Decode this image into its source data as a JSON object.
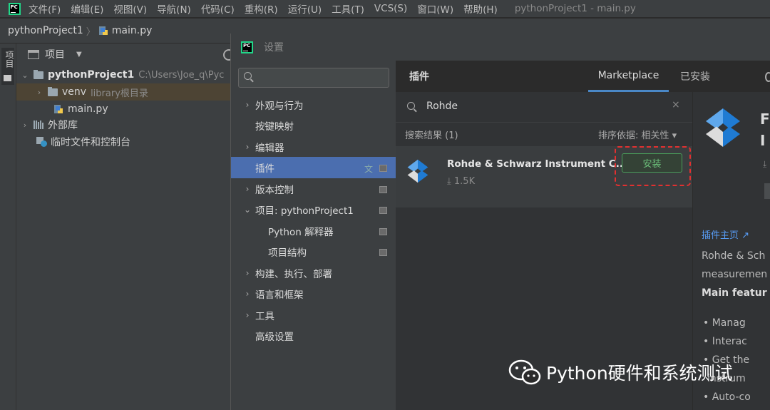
{
  "menubar": {
    "logo_text": "PC",
    "items": [
      "文件(F)",
      "编辑(E)",
      "视图(V)",
      "导航(N)",
      "代码(C)",
      "重构(R)",
      "运行(U)",
      "工具(T)",
      "VCS(S)",
      "窗口(W)",
      "帮助(H)"
    ],
    "window_title": "pythonProject1 - main.py"
  },
  "navbar": {
    "project": "pythonProject1",
    "separator": "〉",
    "file": "main.py"
  },
  "stripe": {
    "tab_label": "项目"
  },
  "project_panel": {
    "header": "项目",
    "root_name": "pythonProject1",
    "root_path": "C:\\Users\\Joe_q\\Pyc",
    "venv": "venv",
    "venv_hint": "library根目录",
    "main_file": "main.py",
    "external_libs": "外部库",
    "scratches": "临时文件和控制台"
  },
  "dialog": {
    "title": "设置",
    "nav": [
      {
        "label": "外观与行为",
        "arrow": "›"
      },
      {
        "label": "按键映射",
        "arrow": ""
      },
      {
        "label": "编辑器",
        "arrow": "›"
      },
      {
        "label": "插件",
        "arrow": "",
        "selected": true
      },
      {
        "label": "版本控制",
        "arrow": "›"
      },
      {
        "label": "项目: pythonProject1",
        "arrow": "⌄"
      },
      {
        "label": "Python 解释器",
        "arrow": ""
      },
      {
        "label": "项目结构",
        "arrow": ""
      },
      {
        "label": "构建、执行、部署",
        "arrow": "›"
      },
      {
        "label": "语言和框架",
        "arrow": "›"
      },
      {
        "label": "工具",
        "arrow": "›"
      },
      {
        "label": "高级设置",
        "arrow": ""
      }
    ],
    "plugins_header": "插件",
    "tab_marketplace": "Marketplace",
    "tab_installed": "已安装",
    "search_value": "Rohde",
    "results_label": "搜索结果 (1)",
    "sort_label": "排序依据: 相关性",
    "plugin_name": "Rohde & Schwarz Instrument C...",
    "plugin_downloads": "1.5K",
    "install_button": "安装",
    "detail": {
      "title_fragment_1": "F",
      "title_fragment_2": "I",
      "homepage": "插件主页",
      "desc_line1": "Rohde & Sch",
      "desc_line2": "measuremen",
      "features_heading": "Main featur",
      "bullets": [
        "Manag",
        "Interac",
        "Get the",
        "instrum",
        "Auto-co"
      ]
    }
  },
  "watermark": {
    "text": "Python硬件和系统测试"
  },
  "colors": {
    "accent": "#4b6eaf",
    "install_green": "#4a9e5a",
    "highlight_red": "#e23030",
    "link": "#589df6"
  }
}
